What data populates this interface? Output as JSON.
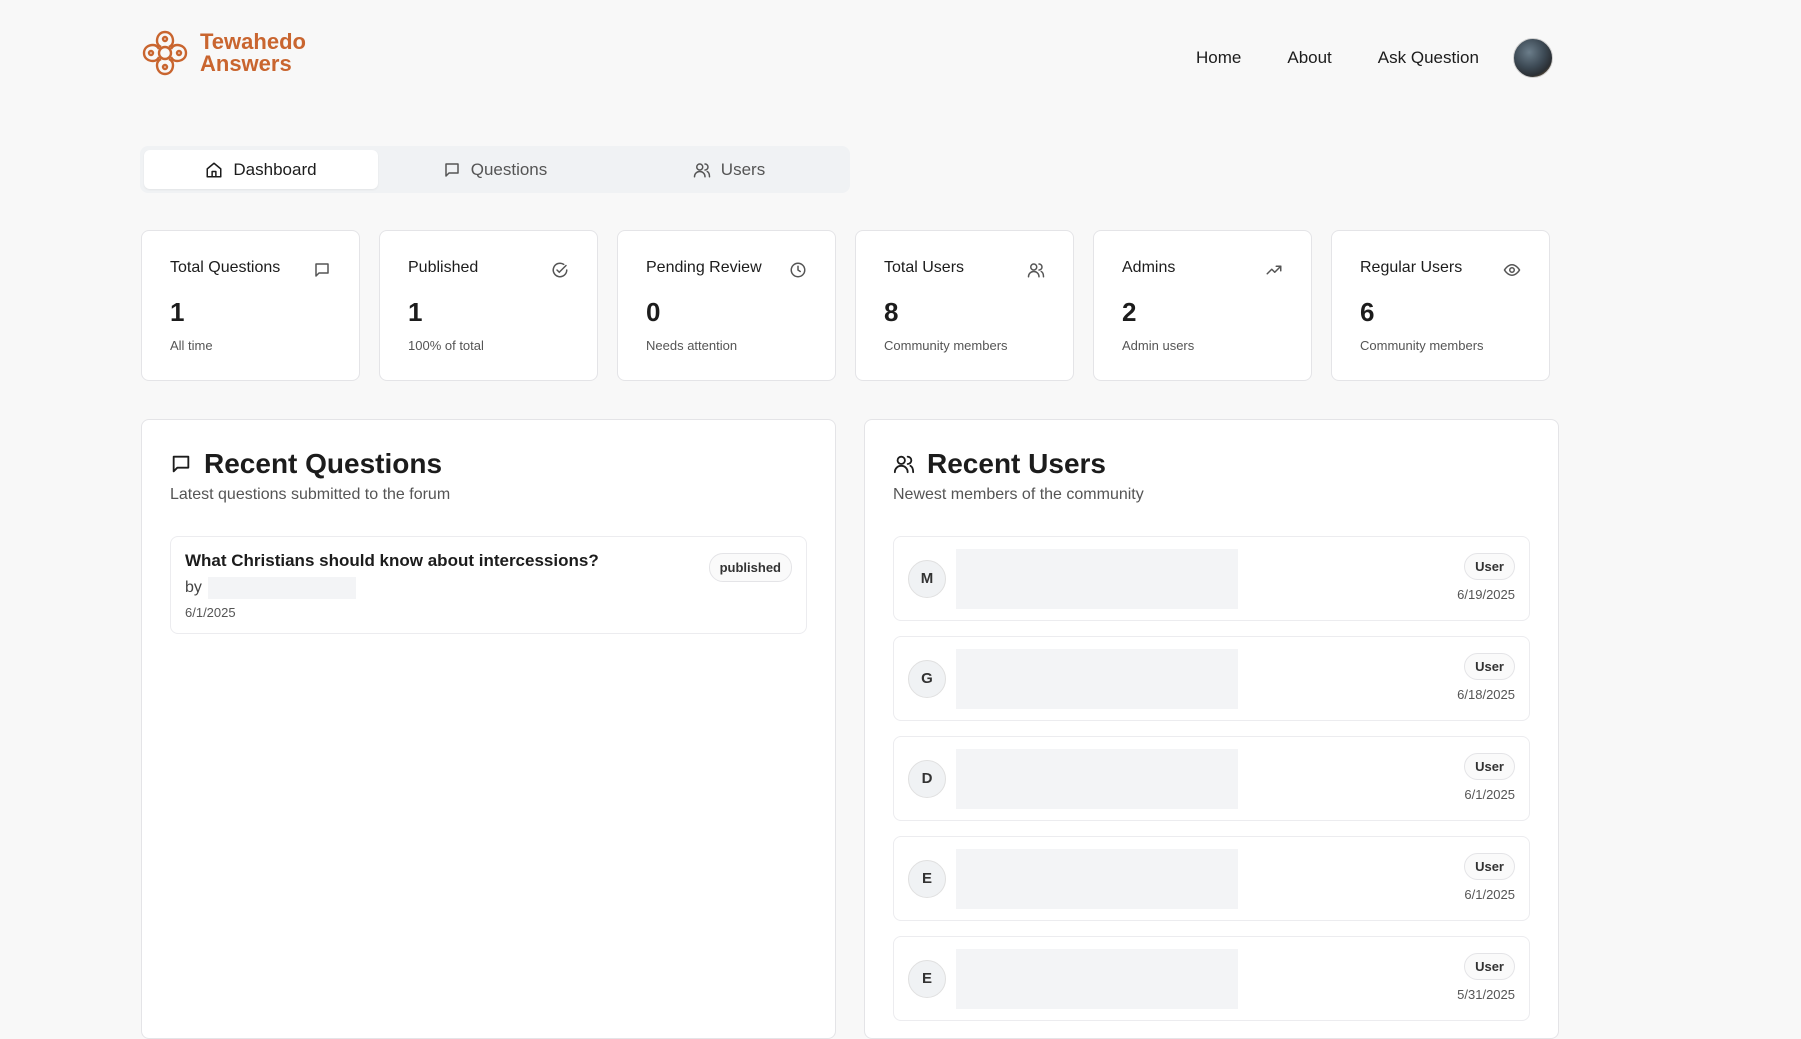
{
  "brand": {
    "line1": "Tewahedo",
    "line2": "Answers",
    "color": "#c9652f"
  },
  "nav": {
    "home": "Home",
    "about": "About",
    "ask": "Ask Question"
  },
  "tabs": [
    {
      "label": "Dashboard",
      "icon": "home-icon",
      "active": true
    },
    {
      "label": "Questions",
      "icon": "message-square-icon",
      "active": false
    },
    {
      "label": "Users",
      "icon": "users-icon",
      "active": false
    }
  ],
  "stats": [
    {
      "title": "Total Questions",
      "value": "1",
      "sub": "All time",
      "icon": "message-square-icon"
    },
    {
      "title": "Published",
      "value": "1",
      "sub": "100% of total",
      "icon": "check-circle-icon"
    },
    {
      "title": "Pending Review",
      "value": "0",
      "sub": "Needs attention",
      "icon": "clock-icon"
    },
    {
      "title": "Total Users",
      "value": "8",
      "sub": "Community members",
      "icon": "users-icon"
    },
    {
      "title": "Admins",
      "value": "2",
      "sub": "Admin users",
      "icon": "trending-up-icon"
    },
    {
      "title": "Regular Users",
      "value": "6",
      "sub": "Community members",
      "icon": "eye-icon"
    }
  ],
  "recent_questions": {
    "title": "Recent Questions",
    "subtitle": "Latest questions submitted to the forum",
    "items": [
      {
        "title": "What Christians should know about intercessions?",
        "by": "by",
        "date": "6/1/2025",
        "status": "published"
      }
    ]
  },
  "recent_users": {
    "title": "Recent Users",
    "subtitle": "Newest members of the community",
    "items": [
      {
        "initial": "M",
        "role": "User",
        "date": "6/19/2025"
      },
      {
        "initial": "G",
        "role": "User",
        "date": "6/18/2025"
      },
      {
        "initial": "D",
        "role": "User",
        "date": "6/1/2025"
      },
      {
        "initial": "E",
        "role": "User",
        "date": "6/1/2025"
      },
      {
        "initial": "E",
        "role": "User",
        "date": "5/31/2025"
      }
    ]
  }
}
